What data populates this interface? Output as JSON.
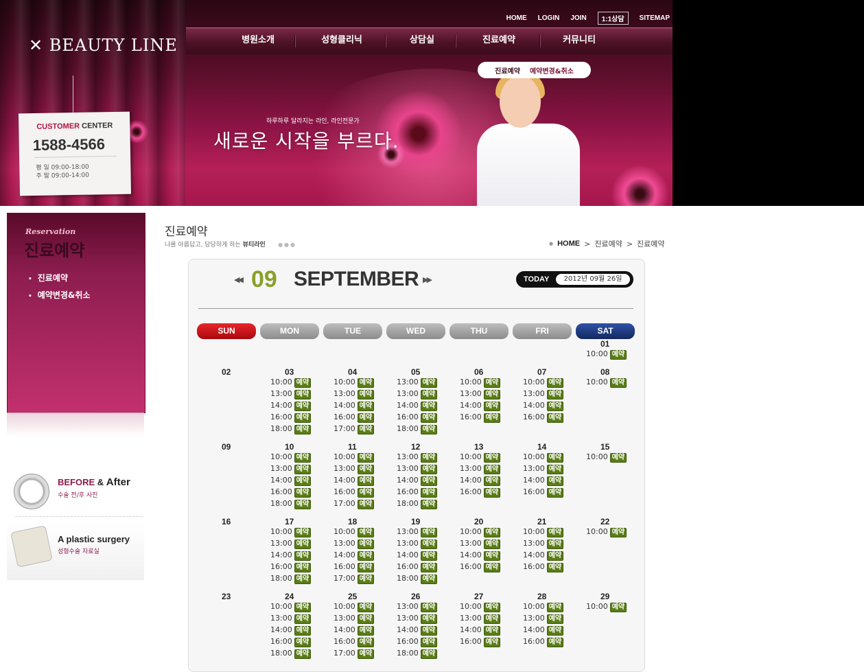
{
  "header": {
    "logo": "✕ BEAUTY LINE",
    "top_menu": [
      "HOME",
      "LOGIN",
      "JOIN",
      "1:1상담",
      "SITEMAP"
    ],
    "gnb": [
      "병원소개",
      "성형클리닉",
      "상담실",
      "진료예약",
      "커뮤니티"
    ],
    "subnav": [
      "진료예약",
      "예약변경&취소"
    ],
    "tagline_small": "하루하루 달라지는 라인, 라인전문가",
    "tagline": "새로운 시작을 부르다.",
    "customer_center": {
      "title_a": "CUSTOMER",
      "title_b": " CENTER",
      "phone": "1588-4566",
      "hours_weekday": "평  일 09:00-18:00",
      "hours_sat": "주  말 09:00-14:00"
    }
  },
  "sidebar": {
    "label_en": "Reservation",
    "title": "진료예약",
    "items": [
      "진료예약",
      "예약변경&취소"
    ],
    "banners": [
      {
        "title_a": "BEFORE",
        "title_amp": " & ",
        "title_b": "After",
        "sub": "수술 전/후 사진"
      },
      {
        "title": "A plastic surgery",
        "sub": "성형수술 자료실"
      }
    ]
  },
  "content": {
    "page_title": "진료예약",
    "page_desc_a": "나를 아름답고, 당당하게 하는 ",
    "page_desc_b": "뷰티라인",
    "breadcrumb": [
      "HOME",
      "진료예약",
      "진료예약"
    ],
    "calendar": {
      "month_num": "09",
      "month_name": "SEPTEMBER",
      "today_label": "TODAY",
      "today_value": "2012년 09월 26일",
      "weekdays": [
        "SUN",
        "MON",
        "TUE",
        "WED",
        "THU",
        "FRI",
        "SAT"
      ],
      "reserve_label": "예약",
      "weeks": [
        [
          null,
          null,
          null,
          null,
          null,
          null,
          {
            "d": "01",
            "t": [
              "10:00"
            ]
          }
        ],
        [
          {
            "d": "02",
            "t": []
          },
          {
            "d": "03",
            "t": [
              "10:00",
              "13:00",
              "14:00",
              "16:00",
              "18:00"
            ]
          },
          {
            "d": "04",
            "t": [
              "10:00",
              "13:00",
              "14:00",
              "16:00",
              "17:00"
            ]
          },
          {
            "d": "05",
            "t": [
              "13:00",
              "13:00",
              "14:00",
              "16:00",
              "18:00"
            ]
          },
          {
            "d": "06",
            "t": [
              "10:00",
              "13:00",
              "14:00",
              "16:00"
            ]
          },
          {
            "d": "07",
            "t": [
              "10:00",
              "13:00",
              "14:00",
              "16:00"
            ]
          },
          {
            "d": "08",
            "t": [
              "10:00"
            ]
          }
        ],
        [
          {
            "d": "09",
            "t": []
          },
          {
            "d": "10",
            "t": [
              "10:00",
              "13:00",
              "14:00",
              "16:00",
              "18:00"
            ]
          },
          {
            "d": "11",
            "t": [
              "10:00",
              "13:00",
              "14:00",
              "16:00",
              "17:00"
            ]
          },
          {
            "d": "12",
            "t": [
              "13:00",
              "13:00",
              "14:00",
              "16:00",
              "18:00"
            ]
          },
          {
            "d": "13",
            "t": [
              "10:00",
              "13:00",
              "14:00",
              "16:00"
            ]
          },
          {
            "d": "14",
            "t": [
              "10:00",
              "13:00",
              "14:00",
              "16:00"
            ]
          },
          {
            "d": "15",
            "t": [
              "10:00"
            ]
          }
        ],
        [
          {
            "d": "16",
            "t": []
          },
          {
            "d": "17",
            "t": [
              "10:00",
              "13:00",
              "14:00",
              "16:00",
              "18:00"
            ]
          },
          {
            "d": "18",
            "t": [
              "10:00",
              "13:00",
              "14:00",
              "16:00",
              "17:00"
            ]
          },
          {
            "d": "19",
            "t": [
              "13:00",
              "13:00",
              "14:00",
              "16:00",
              "18:00"
            ]
          },
          {
            "d": "20",
            "t": [
              "10:00",
              "13:00",
              "14:00",
              "16:00"
            ]
          },
          {
            "d": "21",
            "t": [
              "10:00",
              "13:00",
              "14:00",
              "16:00"
            ]
          },
          {
            "d": "22",
            "t": [
              "10:00"
            ]
          }
        ],
        [
          {
            "d": "23",
            "t": []
          },
          {
            "d": "24",
            "t": [
              "10:00",
              "13:00",
              "14:00",
              "16:00",
              "18:00"
            ]
          },
          {
            "d": "25",
            "t": [
              "10:00",
              "13:00",
              "14:00",
              "16:00",
              "17:00"
            ]
          },
          {
            "d": "26",
            "t": [
              "13:00",
              "13:00",
              "14:00",
              "16:00",
              "18:00"
            ]
          },
          {
            "d": "27",
            "t": [
              "10:00",
              "13:00",
              "14:00",
              "16:00"
            ]
          },
          {
            "d": "28",
            "t": [
              "10:00",
              "13:00",
              "14:00",
              "16:00"
            ]
          },
          {
            "d": "29",
            "t": [
              "10:00"
            ]
          }
        ]
      ]
    }
  },
  "colors": {
    "brand": "#8e1446",
    "reserve_btn": "#5a7d17",
    "month_num": "#8aa028",
    "sun": "#d01a1a",
    "sat": "#1c3b86"
  }
}
